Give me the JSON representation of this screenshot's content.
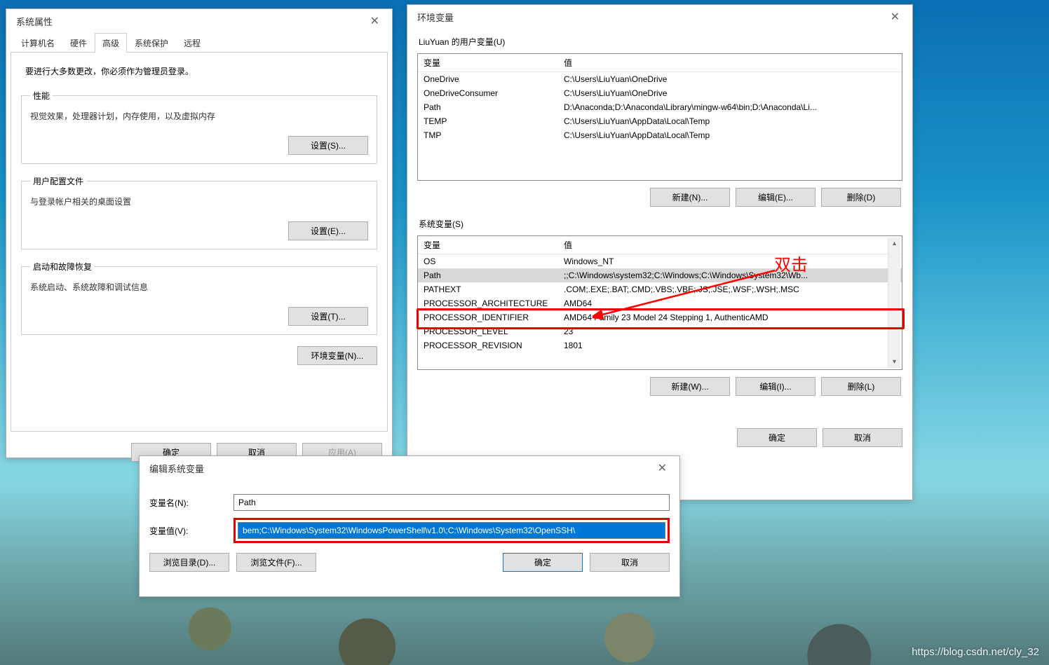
{
  "sysprop": {
    "title": "系统属性",
    "tabs": [
      "计算机名",
      "硬件",
      "高级",
      "系统保护",
      "远程"
    ],
    "active_tab": 2,
    "note": "要进行大多数更改，你必须作为管理员登录。",
    "perf": {
      "legend": "性能",
      "text": "视觉效果，处理器计划，内存使用，以及虚拟内存",
      "btn": "设置(S)..."
    },
    "profile": {
      "legend": "用户配置文件",
      "text": "与登录帐户相关的桌面设置",
      "btn": "设置(E)..."
    },
    "startup": {
      "legend": "启动和故障恢复",
      "text": "系统启动、系统故障和调试信息",
      "btn": "设置(T)..."
    },
    "envbtn": "环境变量(N)...",
    "ok": "确定",
    "cancel": "取消",
    "apply": "应用(A)"
  },
  "env": {
    "title": "环境变量",
    "user_section": "LiuYuan 的用户变量(U)",
    "col_var": "变量",
    "col_val": "值",
    "user_vars": [
      {
        "k": "OneDrive",
        "v": "C:\\Users\\LiuYuan\\OneDrive"
      },
      {
        "k": "OneDriveConsumer",
        "v": "C:\\Users\\LiuYuan\\OneDrive"
      },
      {
        "k": "Path",
        "v": "D:\\Anaconda;D:\\Anaconda\\Library\\mingw-w64\\bin;D:\\Anaconda\\Li..."
      },
      {
        "k": "TEMP",
        "v": "C:\\Users\\LiuYuan\\AppData\\Local\\Temp"
      },
      {
        "k": "TMP",
        "v": "C:\\Users\\LiuYuan\\AppData\\Local\\Temp"
      }
    ],
    "new_u": "新建(N)...",
    "edit_u": "编辑(E)...",
    "del_u": "删除(D)",
    "sys_section": "系统变量(S)",
    "sys_vars": [
      {
        "k": "OS",
        "v": "Windows_NT"
      },
      {
        "k": "Path",
        "v": ";;C:\\Windows\\system32;C:\\Windows;C:\\Windows\\System32\\Wb..."
      },
      {
        "k": "PATHEXT",
        "v": ".COM;.EXE;.BAT;.CMD;.VBS;.VBE;.JS;.JSE;.WSF;.WSH;.MSC"
      },
      {
        "k": "PROCESSOR_ARCHITECTURE",
        "v": "AMD64"
      },
      {
        "k": "PROCESSOR_IDENTIFIER",
        "v": "AMD64 Family 23 Model 24 Stepping 1, AuthenticAMD"
      },
      {
        "k": "PROCESSOR_LEVEL",
        "v": "23"
      },
      {
        "k": "PROCESSOR_REVISION",
        "v": "1801"
      }
    ],
    "sys_sel_index": 1,
    "new_s": "新建(W)...",
    "edit_s": "编辑(I)...",
    "del_s": "删除(L)",
    "ok": "确定",
    "cancel": "取消"
  },
  "edit": {
    "title": "编辑系统变量",
    "name_label": "变量名(N):",
    "name_value": "Path",
    "value_label": "变量值(V):",
    "value_value": "bem;C:\\Windows\\System32\\WindowsPowerShell\\v1.0\\;C:\\Windows\\System32\\OpenSSH\\",
    "browse_dir": "浏览目录(D)...",
    "browse_file": "浏览文件(F)...",
    "ok": "确定",
    "cancel": "取消"
  },
  "annotation_text": "双击",
  "watermark": "https://blog.csdn.net/cly_32"
}
